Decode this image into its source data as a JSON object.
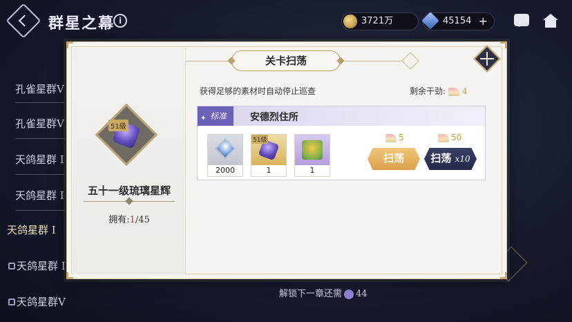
{
  "header": {
    "title": "群星之幕",
    "gold": "3721万",
    "gems": "45154"
  },
  "background": {
    "side_items": [
      {
        "label": "孔雀星群V",
        "locked": false
      },
      {
        "label": "孔雀星群V",
        "locked": false
      },
      {
        "label": "天鸽星群 I",
        "locked": false
      },
      {
        "label": "天鸽星群 I",
        "locked": false
      },
      {
        "label": "天鸽星群 I",
        "locked": false
      },
      {
        "label": "天鸽星群 I",
        "locked": true
      },
      {
        "label": "天鸽星群V",
        "locked": true
      }
    ],
    "unlock_hint": "解锁下一章还需",
    "unlock_count": "44"
  },
  "modal": {
    "title": "关卡扫荡",
    "hint": "获得足够的素材时自动停止巡查",
    "stamina_label": "剩余干劲:",
    "stamina_value": "4",
    "item": {
      "level_badge": "51级",
      "name": "五十一级琉璃星辉",
      "own_label": "拥有:",
      "own_current": "1",
      "own_target": "/45"
    },
    "stage": {
      "tag": "标准",
      "name": "安德烈住所",
      "rewards": [
        {
          "qty": "2000",
          "badge": ""
        },
        {
          "qty": "1",
          "badge": "51级"
        },
        {
          "qty": "1",
          "badge": ""
        }
      ],
      "sweep_cost": "5",
      "sweep10_cost": "50",
      "sweep_label": "扫荡",
      "sweep10_label": "扫荡",
      "sweep10_suffix": "x10"
    }
  }
}
